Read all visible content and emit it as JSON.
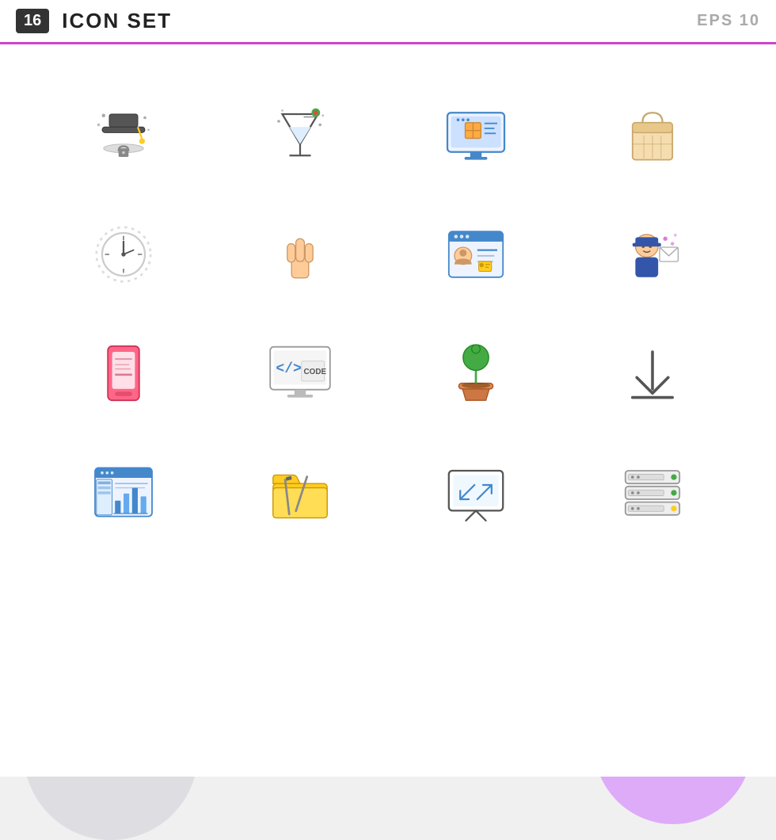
{
  "header": {
    "badge": "16",
    "title": "ICON SET",
    "eps": "EPS 10"
  },
  "icons": [
    {
      "id": "graduation-cap",
      "label": "Graduation Cap"
    },
    {
      "id": "cocktail",
      "label": "Cocktail"
    },
    {
      "id": "desktop-package",
      "label": "Desktop Package"
    },
    {
      "id": "shopping-bag",
      "label": "Shopping Bag"
    },
    {
      "id": "clock",
      "label": "Clock"
    },
    {
      "id": "hand-gesture",
      "label": "Hand Gesture"
    },
    {
      "id": "profile-card",
      "label": "Profile Card"
    },
    {
      "id": "postman",
      "label": "Postman"
    },
    {
      "id": "tablet",
      "label": "Tablet"
    },
    {
      "id": "code-monitor",
      "label": "Code Monitor"
    },
    {
      "id": "plant",
      "label": "Plant"
    },
    {
      "id": "download",
      "label": "Download"
    },
    {
      "id": "dashboard",
      "label": "Dashboard"
    },
    {
      "id": "folder-tools",
      "label": "Folder Tools"
    },
    {
      "id": "presentation",
      "label": "Presentation"
    },
    {
      "id": "server",
      "label": "Server"
    }
  ],
  "colors": {
    "accent_purple": "#cc44cc",
    "bg_purple": "#cc66ff",
    "icon_blue": "#4488cc",
    "icon_orange": "#ffaa44",
    "icon_red": "#ee4444",
    "icon_green": "#44aa44",
    "icon_yellow": "#ffcc22",
    "icon_brown": "#cc9966",
    "icon_pink": "#ff6688",
    "icon_light_blue": "#66aaee"
  }
}
